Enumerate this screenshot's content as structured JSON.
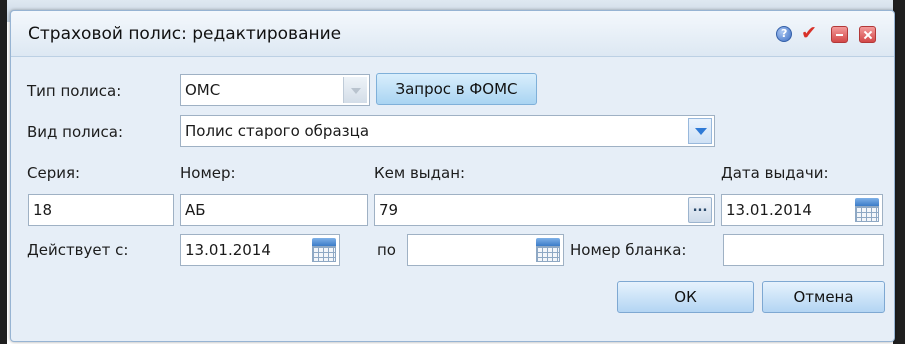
{
  "dialog": {
    "title": "Страховой полис: редактирование"
  },
  "form": {
    "policy_type_label": "Тип полиса:",
    "policy_type_value": "ОМС",
    "fomс_request_button": "Запрос в ФОМС",
    "policy_kind_label": "Вид полиса:",
    "policy_kind_value": "Полис старого образца",
    "series_label": "Серия:",
    "series_value": "18",
    "number_label": "Номер:",
    "number_value": "АБ",
    "issued_by_label": "Кем выдан:",
    "issued_by_value": "79",
    "issue_date_label": "Дата выдачи:",
    "issue_date_value": "13.01.2014",
    "valid_from_label": "Действует с:",
    "valid_from_value": "13.01.2014",
    "valid_to_label": "по",
    "valid_to_value": "",
    "blank_number_label": "Номер бланка:",
    "blank_number_value": "",
    "ellipsis": "..."
  },
  "buttons": {
    "ok": "ОК",
    "cancel": "Отмена"
  },
  "icons": [
    "help-icon",
    "apply-check-icon",
    "minimize-icon",
    "close-icon",
    "calendar-icon",
    "dropdown-arrow-icon"
  ],
  "colors": {
    "dialog_bg": "#e6eef7",
    "button_blue": "#b3d5f3",
    "title_icons_red": "#d24848",
    "check_red": "#d8322a"
  }
}
